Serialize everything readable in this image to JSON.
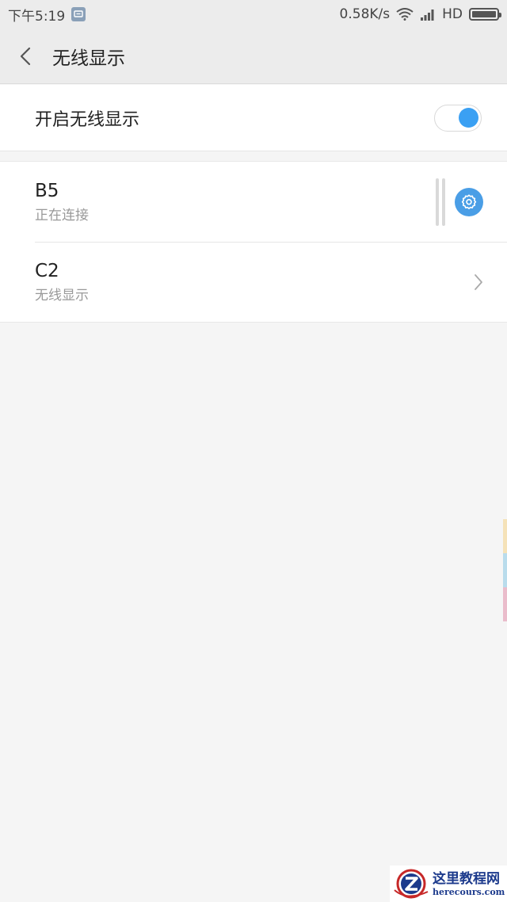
{
  "status_bar": {
    "time": "下午5:19",
    "net_speed": "0.58K/s",
    "network_type": "HD",
    "battery_level": 1.0
  },
  "header": {
    "title": "无线显示"
  },
  "toggle": {
    "label": "开启无线显示",
    "enabled": true,
    "accent": "#3aa0f3"
  },
  "devices": [
    {
      "name": "B5",
      "status": "正在连接",
      "action_icon": "settings-gear-icon"
    },
    {
      "name": "C2",
      "status": "无线显示",
      "action_icon": "chevron-right-icon"
    }
  ],
  "side_tabs": [
    "#f5e2b8",
    "#b9dcec",
    "#eabccb"
  ],
  "watermark": {
    "title": "这里教程网",
    "subtitle": "herecours.com"
  }
}
